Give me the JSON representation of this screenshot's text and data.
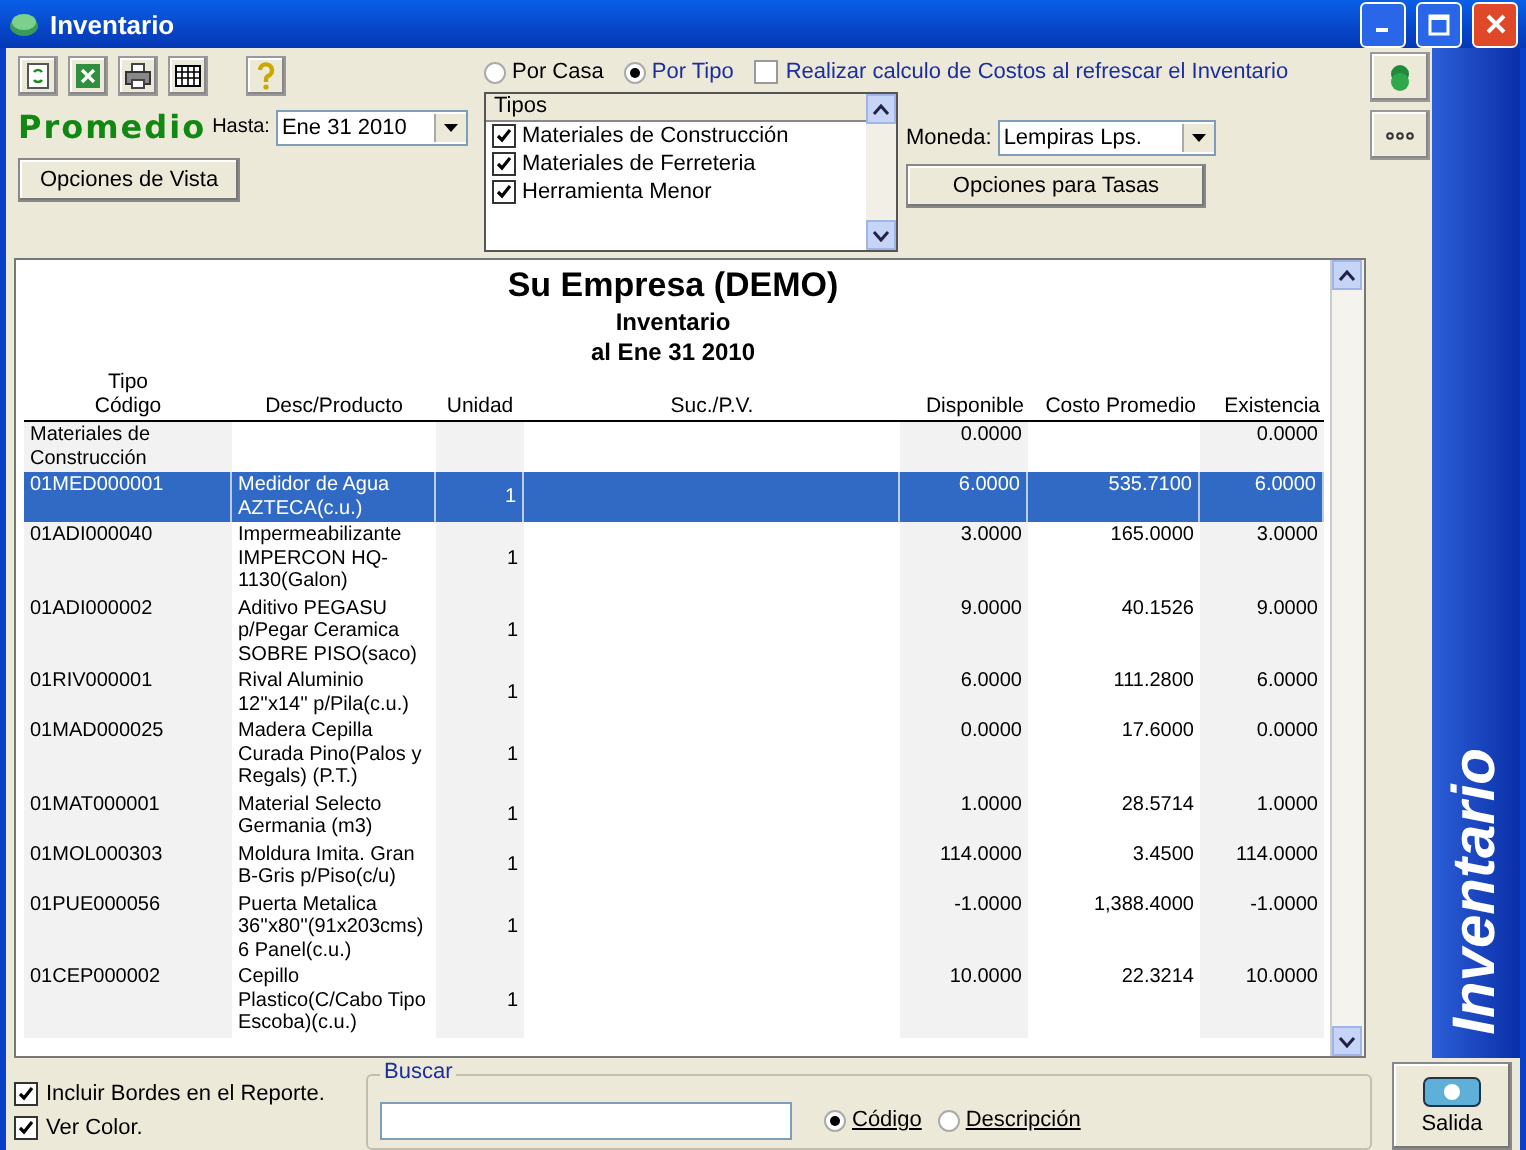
{
  "window": {
    "title": "Inventario"
  },
  "mode_label": "Promedio",
  "date_field": {
    "label": "Hasta:",
    "value": "Ene  31  2010"
  },
  "view_options_button": "Opciones de Vista",
  "grouping": [
    {
      "label": "Por Casa",
      "selected": false
    },
    {
      "label": "Por Tipo",
      "selected": true
    }
  ],
  "recalc_checkbox": {
    "label": "Realizar calculo de Costos al refrescar el Inventario",
    "checked": false
  },
  "types_list": {
    "header": "Tipos",
    "items": [
      {
        "label": "Materiales de Construcción",
        "checked": true
      },
      {
        "label": "Materiales de Ferreteria",
        "checked": true
      },
      {
        "label": "Herramienta Menor",
        "checked": true
      }
    ]
  },
  "currency": {
    "label": "Moneda:",
    "value": "Lempiras Lps."
  },
  "rates_button": "Opciones para Tasas",
  "report": {
    "title": "Su Empresa (DEMO)",
    "subtitle": "Inventario",
    "date": "al Ene  31  2010",
    "group_label": "Tipo",
    "columns": [
      "Código",
      "Desc/Producto",
      "Unidad",
      "Suc./P.V.",
      "Disponible",
      "Costo Promedio",
      "Existencia"
    ],
    "rows": [
      {
        "kind": "group",
        "selected": false,
        "cells": [
          "Materiales de Construcción",
          null,
          null,
          null,
          "0.0000",
          null,
          "0.0000"
        ]
      },
      {
        "kind": "item",
        "selected": true,
        "cells": [
          "01MED000001",
          "Medidor de Agua AZTECA(c.u.)",
          "1",
          null,
          "6.0000",
          "535.7100",
          "6.0000"
        ]
      },
      {
        "kind": "item",
        "selected": false,
        "cells": [
          "01ADI000040",
          "Impermeabilizante IMPERCON HQ-1130(Galon)",
          "1",
          null,
          "3.0000",
          "165.0000",
          "3.0000"
        ]
      },
      {
        "kind": "item",
        "selected": false,
        "cells": [
          "01ADI000002",
          "Aditivo PEGASU p/Pegar Ceramica SOBRE PISO(saco)",
          "1",
          null,
          "9.0000",
          "40.1526",
          "9.0000"
        ]
      },
      {
        "kind": "item",
        "selected": false,
        "cells": [
          "01RIV000001",
          "Rival Aluminio 12''x14'' p/Pila(c.u.)",
          "1",
          null,
          "6.0000",
          "111.2800",
          "6.0000"
        ]
      },
      {
        "kind": "item",
        "selected": false,
        "cells": [
          "01MAD000025",
          "Madera Cepilla Curada Pino(Palos y Regals) (P.T.)",
          "1",
          null,
          "0.0000",
          "17.6000",
          "0.0000"
        ]
      },
      {
        "kind": "item",
        "selected": false,
        "cells": [
          "01MAT000001",
          "Material Selecto Germania  (m3)",
          "1",
          null,
          "1.0000",
          "28.5714",
          "1.0000"
        ]
      },
      {
        "kind": "item",
        "selected": false,
        "cells": [
          "01MOL000303",
          "Moldura Imita. Gran B-Gris p/Piso(c/u)",
          "1",
          null,
          "114.0000",
          "3.4500",
          "114.0000"
        ]
      },
      {
        "kind": "item",
        "selected": false,
        "cells": [
          "01PUE000056",
          "Puerta Metalica 36''x80''(91x203cms) 6 Panel(c.u.)",
          "1",
          null,
          "-1.0000",
          "1,388.4000",
          "-1.0000"
        ]
      },
      {
        "kind": "item",
        "selected": false,
        "cells": [
          "01CEP000002",
          "Cepillo Plastico(C/Cabo Tipo Escoba)(c.u.)",
          "1",
          null,
          "10.0000",
          "22.3214",
          "10.0000"
        ]
      }
    ]
  },
  "options": [
    {
      "label": "Incluir Bordes en el Reporte.",
      "checked": true
    },
    {
      "label": "Ver Color.",
      "checked": true
    }
  ],
  "search": {
    "legend": "Buscar",
    "by": [
      {
        "label": "Código",
        "selected": true
      },
      {
        "label": "Descripción",
        "selected": false
      }
    ]
  },
  "exit_button": "Salida",
  "side_banner": "Inventario"
}
